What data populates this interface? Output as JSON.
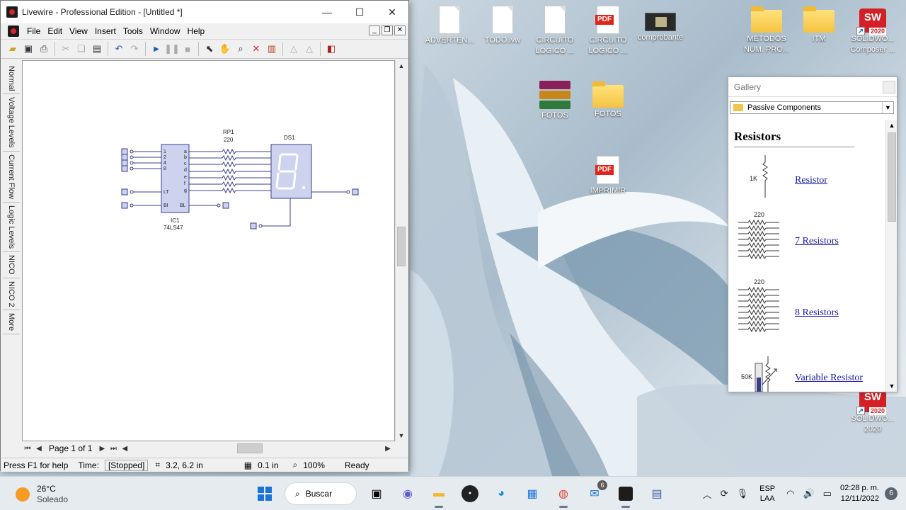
{
  "app": {
    "title": "Livewire - Professional Edition - [Untitled *]",
    "menu": [
      "File",
      "Edit",
      "View",
      "Insert",
      "Tools",
      "Window",
      "Help"
    ],
    "side_tabs": [
      "Normal",
      "Voltage Levels",
      "Current Flow",
      "Logic Levels",
      "NICO",
      "NICO 2",
      "More"
    ],
    "circuit": {
      "ic_name": "IC1",
      "ic_part": "74LS47",
      "ic_left_pins": [
        "1",
        "2",
        "4",
        "8",
        "LT",
        "BI"
      ],
      "ic_right_pins": [
        "a",
        "b",
        "c",
        "d",
        "e",
        "f",
        "g",
        "BL"
      ],
      "rp_name": "RP1",
      "rp_value": "220",
      "ds_name": "DS1"
    },
    "page_label": "Page 1 of 1",
    "status": {
      "help": "Press F1 for help",
      "time_label": "Time:",
      "time_value": "[Stopped]",
      "coords": "3.2, 6.2 in",
      "grid": "0.1 in",
      "zoom": "100%",
      "state": "Ready"
    }
  },
  "desktop_icons": [
    {
      "label": "ADVERTEN...",
      "type": "doc"
    },
    {
      "label": "TODO.lvw",
      "type": "doc"
    },
    {
      "label": "CIRCUITO LOGICO ...",
      "type": "doc"
    },
    {
      "label": "CIRCUITO LOGICO ...",
      "type": "pdf"
    },
    {
      "label": "comprobante",
      "type": "film"
    },
    {
      "label": "METODOS NUM. PRO...",
      "type": "folder"
    },
    {
      "label": "ITM",
      "type": "folder"
    },
    {
      "label": "SOLIDWO... Composer ...",
      "type": "sw"
    },
    {
      "label": "FOTOS",
      "type": "rar"
    },
    {
      "label": "FOTOS",
      "type": "folder"
    },
    {
      "label": "IMPRIMIR",
      "type": "pdf"
    },
    {
      "label": "SOLIDWO... 2020",
      "type": "sw"
    }
  ],
  "icon_badges": {
    "pdf": "PDF",
    "sw": "SW",
    "sw_year": "2020"
  },
  "gallery": {
    "title": "Gallery",
    "category": "Passive Components",
    "section": "Resistors",
    "items": [
      {
        "label": "Resistor",
        "value": "1K"
      },
      {
        "label": "7 Resistors",
        "value": "220"
      },
      {
        "label": "8 Resistors",
        "value": "220"
      },
      {
        "label": "Variable Resistor",
        "value": "50K"
      }
    ]
  },
  "taskbar": {
    "temperature": "26°C",
    "condition": "Soleado",
    "search_label": "Buscar",
    "mail_badge": "6",
    "lang_1": "ESP",
    "lang_2": "LAA",
    "time": "02:28 p. m.",
    "date": "12/11/2022",
    "notifications": "6"
  }
}
